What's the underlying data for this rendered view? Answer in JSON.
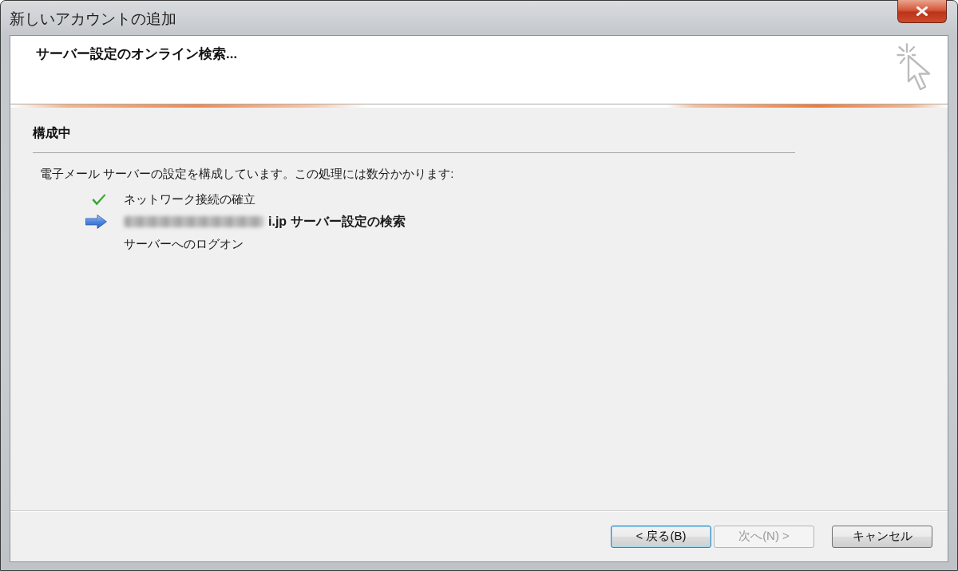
{
  "window": {
    "title": "新しいアカウントの追加"
  },
  "header": {
    "title": "サーバー設定のオンライン検索..."
  },
  "section": {
    "heading": "構成中",
    "description": "電子メール サーバーの設定を構成しています。この処理には数分かかります:"
  },
  "steps": [
    {
      "label": "ネットワーク接続の確立",
      "kind": "done",
      "redacted_prefix": false
    },
    {
      "label": "i.jp サーバー設定の検索",
      "kind": "current",
      "redacted_prefix": true
    },
    {
      "label": "サーバーへのログオン",
      "kind": "pending",
      "redacted_prefix": false
    }
  ],
  "buttons": [
    {
      "label": "< 戻る(B)",
      "disabled": false,
      "default": true
    },
    {
      "label": "次へ(N) >",
      "disabled": true,
      "default": false
    },
    {
      "label": "キャンセル",
      "disabled": false,
      "default": false
    }
  ]
}
